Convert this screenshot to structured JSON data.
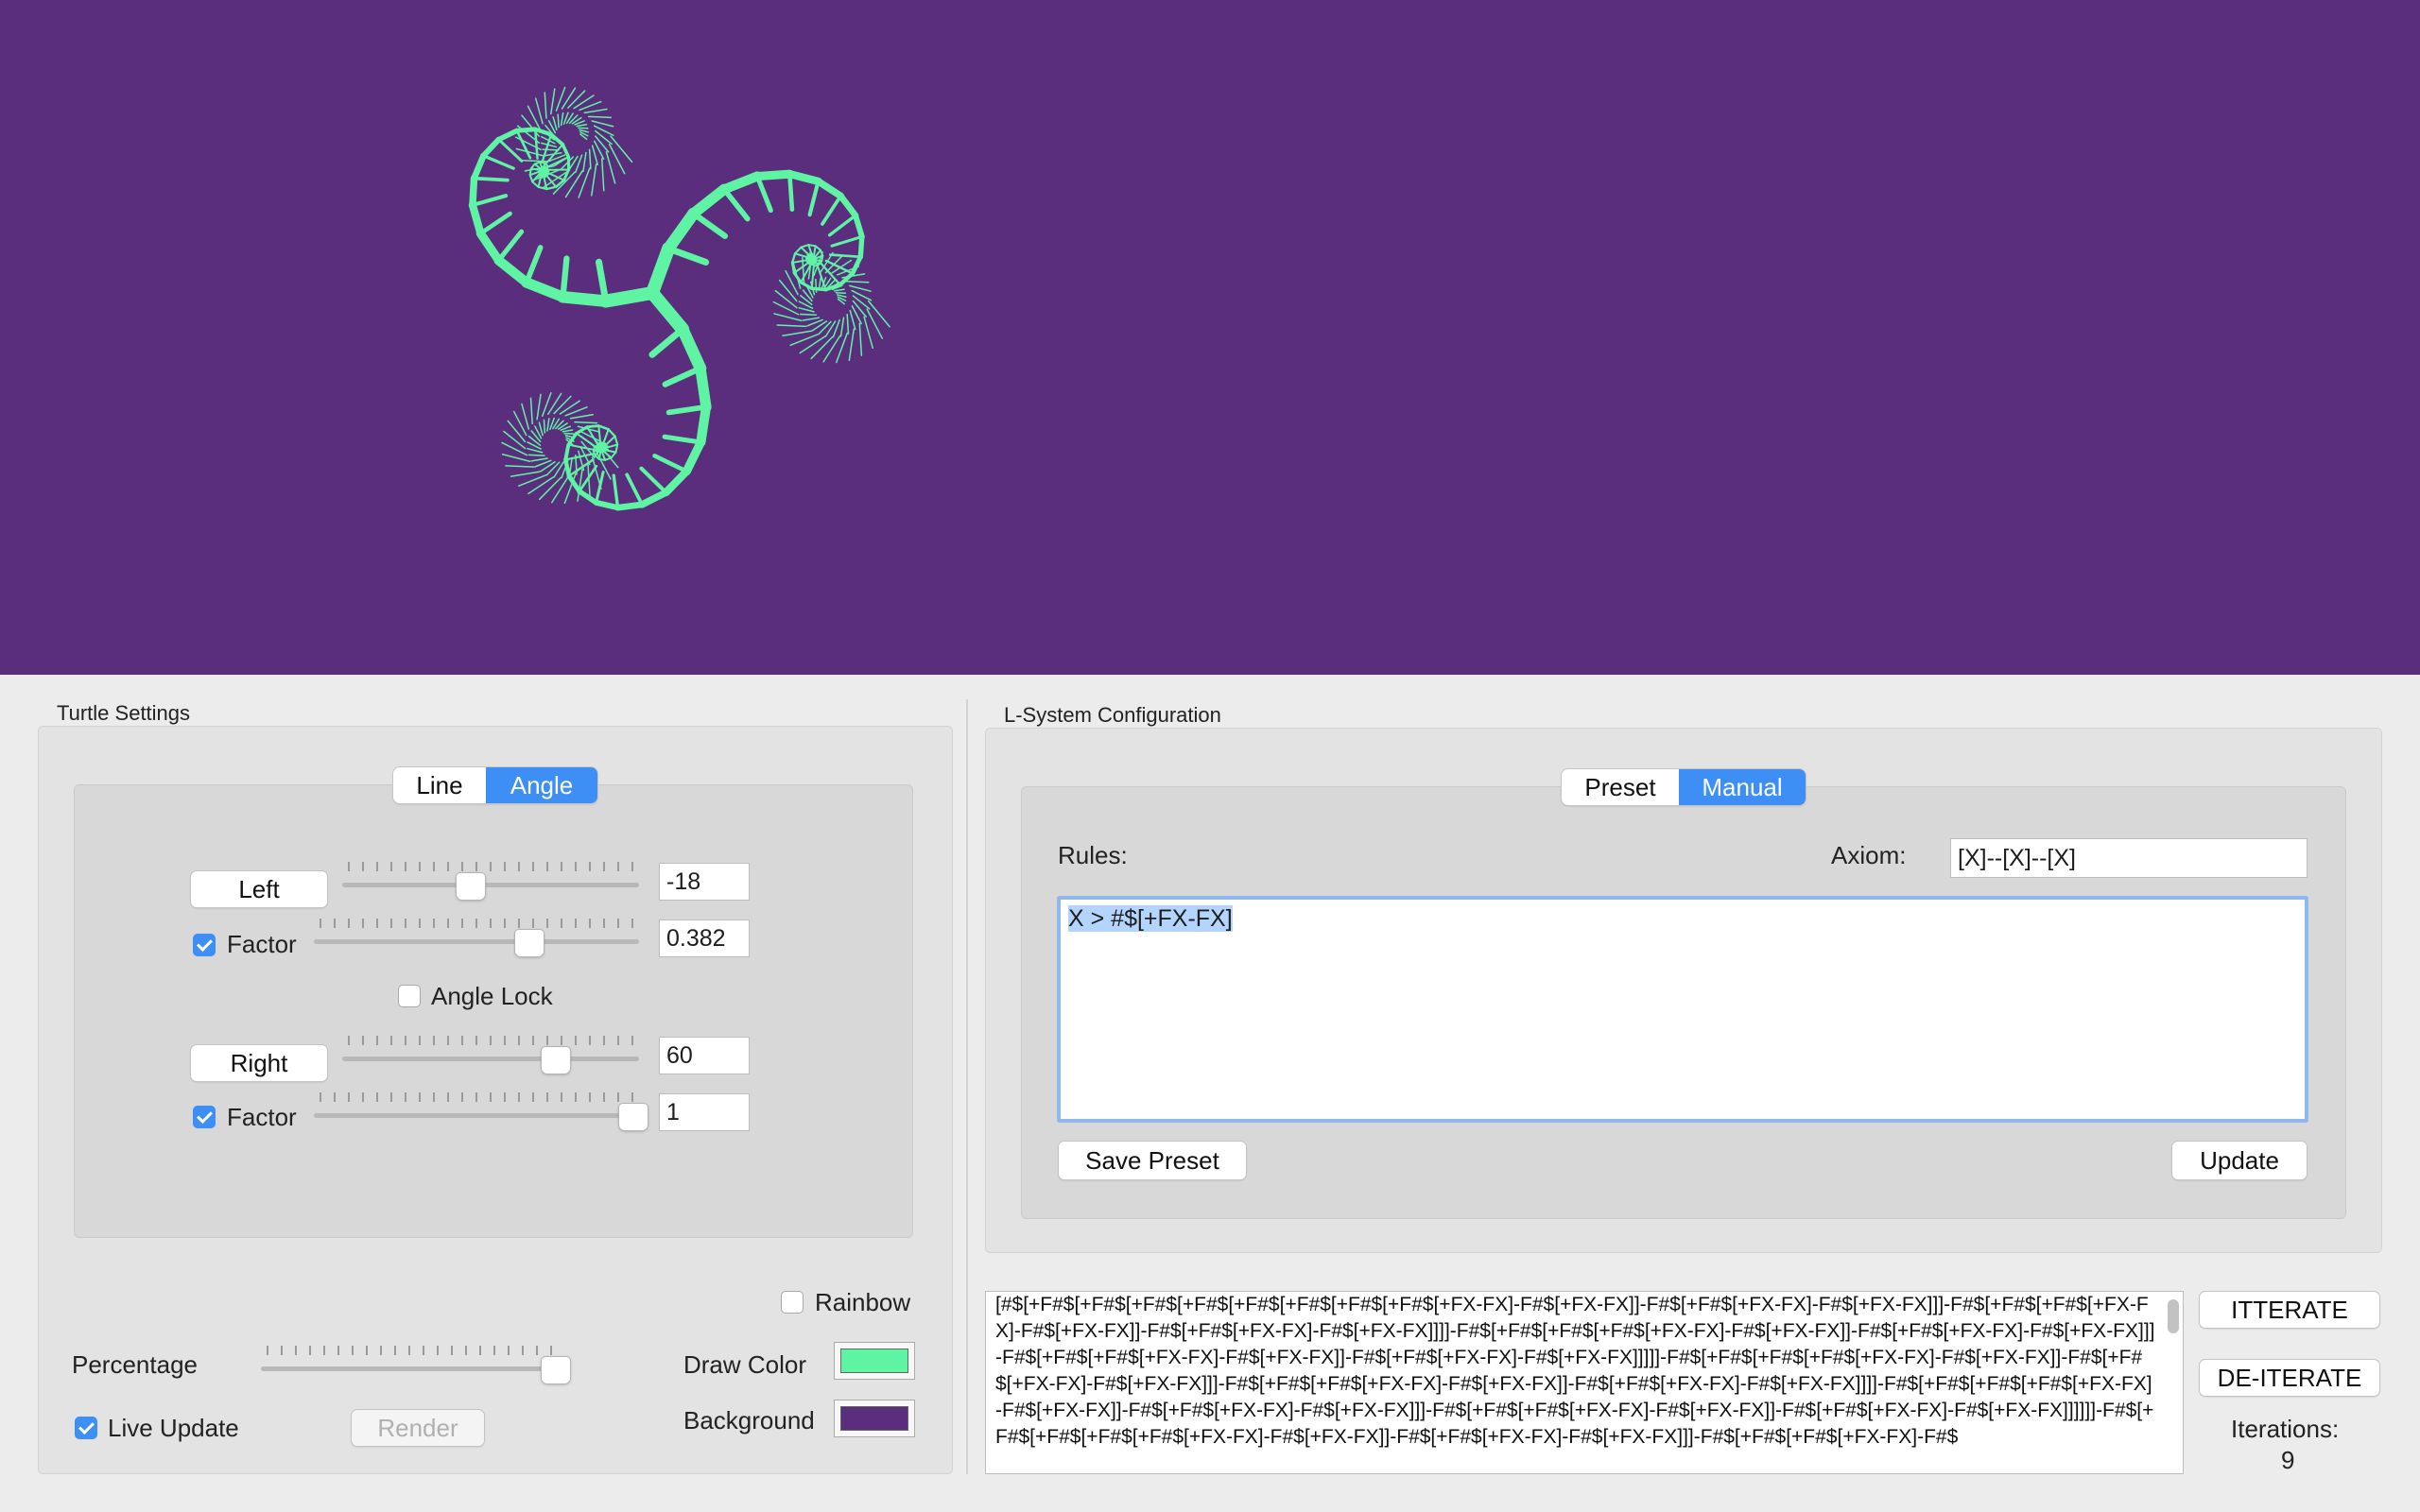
{
  "canvas": {
    "background_color": "#5a2e7c",
    "draw_color": "#5ef4a4"
  },
  "turtle_settings": {
    "title": "Turtle Settings",
    "tabs": [
      {
        "label": "Line",
        "active": false
      },
      {
        "label": "Angle",
        "active": true
      }
    ],
    "left": {
      "button_label": "Left",
      "value": "-18",
      "slider_fraction": 0.43
    },
    "left_factor": {
      "label": "Factor",
      "checked": true,
      "value": "0.382",
      "slider_fraction": 0.67
    },
    "angle_lock": {
      "label": "Angle Lock",
      "checked": false
    },
    "right": {
      "button_label": "Right",
      "value": "60",
      "slider_fraction": 0.73
    },
    "right_factor": {
      "label": "Factor",
      "checked": true,
      "value": "1",
      "slider_fraction": 1.0
    },
    "rainbow": {
      "label": "Rainbow",
      "checked": false
    },
    "percentage": {
      "label": "Percentage",
      "slider_fraction": 1.0
    },
    "draw_color": {
      "label": "Draw Color",
      "color": "#5ef4a4"
    },
    "background": {
      "label": "Background",
      "color": "#5a2e7c"
    },
    "live_update": {
      "label": "Live Update",
      "checked": true
    },
    "render_label": "Render"
  },
  "lsystem": {
    "title": "L-System Configuration",
    "tabs": [
      {
        "label": "Preset",
        "active": false
      },
      {
        "label": "Manual",
        "active": true
      }
    ],
    "rules_label": "Rules:",
    "axiom_label": "Axiom:",
    "axiom_value": "[X]--[X]--[X]",
    "rules_text": "X > #$[+FX-FX]",
    "save_preset_label": "Save Preset",
    "update_label": "Update",
    "output_text": "[#$[+F#$[+F#$[+F#$[+F#$[+F#$[+F#$[+F#$[+F#$[+FX-FX]-F#$[+FX-FX]]-F#$[+F#$[+FX-FX]-F#$[+FX-FX]]]-F#$[+F#$[+F#$[+FX-FX]-F#$[+FX-FX]]-F#$[+F#$[+FX-FX]-F#$[+FX-FX]]]]-F#$[+F#$[+F#$[+F#$[+FX-FX]-F#$[+FX-FX]]-F#$[+F#$[+FX-FX]-F#$[+FX-FX]]]-F#$[+F#$[+F#$[+FX-FX]-F#$[+FX-FX]]-F#$[+F#$[+FX-FX]-F#$[+FX-FX]]]]]-F#$[+F#$[+F#$[+F#$[+FX-FX]-F#$[+FX-FX]]-F#$[+F#$[+FX-FX]-F#$[+FX-FX]]]-F#$[+F#$[+F#$[+FX-FX]-F#$[+FX-FX]]-F#$[+F#$[+FX-FX]-F#$[+FX-FX]]]]-F#$[+F#$[+F#$[+F#$[+FX-FX]-F#$[+FX-FX]]-F#$[+F#$[+FX-FX]-F#$[+FX-FX]]]-F#$[+F#$[+F#$[+FX-FX]-F#$[+FX-FX]]-F#$[+F#$[+FX-FX]-F#$[+FX-FX]]]]]]-F#$[+F#$[+F#$[+F#$[+F#$[+FX-FX]-F#$[+FX-FX]]-F#$[+F#$[+FX-FX]-F#$[+FX-FX]]]-F#$[+F#$[+F#$[+FX-FX]-F#$",
    "iterate_label": "ITTERATE",
    "deiterate_label": "DE-ITERATE",
    "iterations_label": "Iterations:",
    "iterations_value": "9"
  }
}
